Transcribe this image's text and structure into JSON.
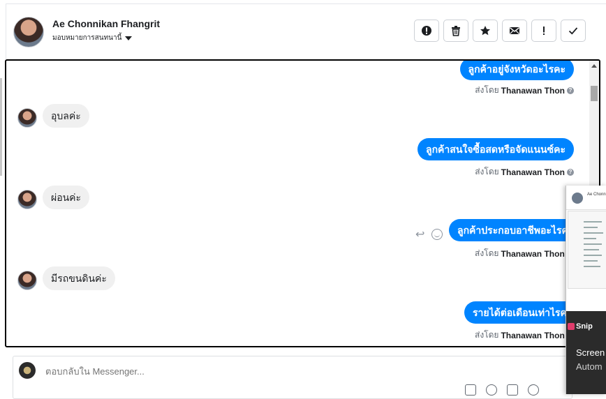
{
  "header": {
    "name": "Ae Chonnikan Fhangrit",
    "assign_label": "มอบหมายการสนทนานี้",
    "actions": [
      {
        "icon": "alert-icon",
        "glyph": "!"
      },
      {
        "icon": "trash-icon"
      },
      {
        "icon": "star-icon",
        "glyph": "★"
      },
      {
        "icon": "envelope-icon"
      },
      {
        "icon": "exclamation-icon",
        "glyph": "!"
      },
      {
        "icon": "check-icon",
        "glyph": "✓"
      }
    ]
  },
  "messages": {
    "m1": "ลูกค้าอยู่จังหวัดอะไรคะ",
    "m2": "อุบลค่ะ",
    "m3": "ลูกค้าสนใจซื้อสดหรือจัดแนนซ์คะ",
    "m4": "ผ่อนค่ะ",
    "m5": "ลูกค้าประกอบอาชีพอะไรคะ",
    "m6": "มีรถขนดินค่ะ",
    "m7": "รายได้ต่อเดือนเท่าไรคะ"
  },
  "sent_by": {
    "prefix": "ส่งโดย",
    "agent": "Thanawan Thon"
  },
  "reply": {
    "placeholder": "ตอบกลับใน Messenger..."
  },
  "overlay": {
    "app": "Snip",
    "line1": "Screen",
    "line2": "Autom"
  },
  "colors": {
    "accent": "#0084ff",
    "incoming_bubble": "#f0f0f0"
  }
}
